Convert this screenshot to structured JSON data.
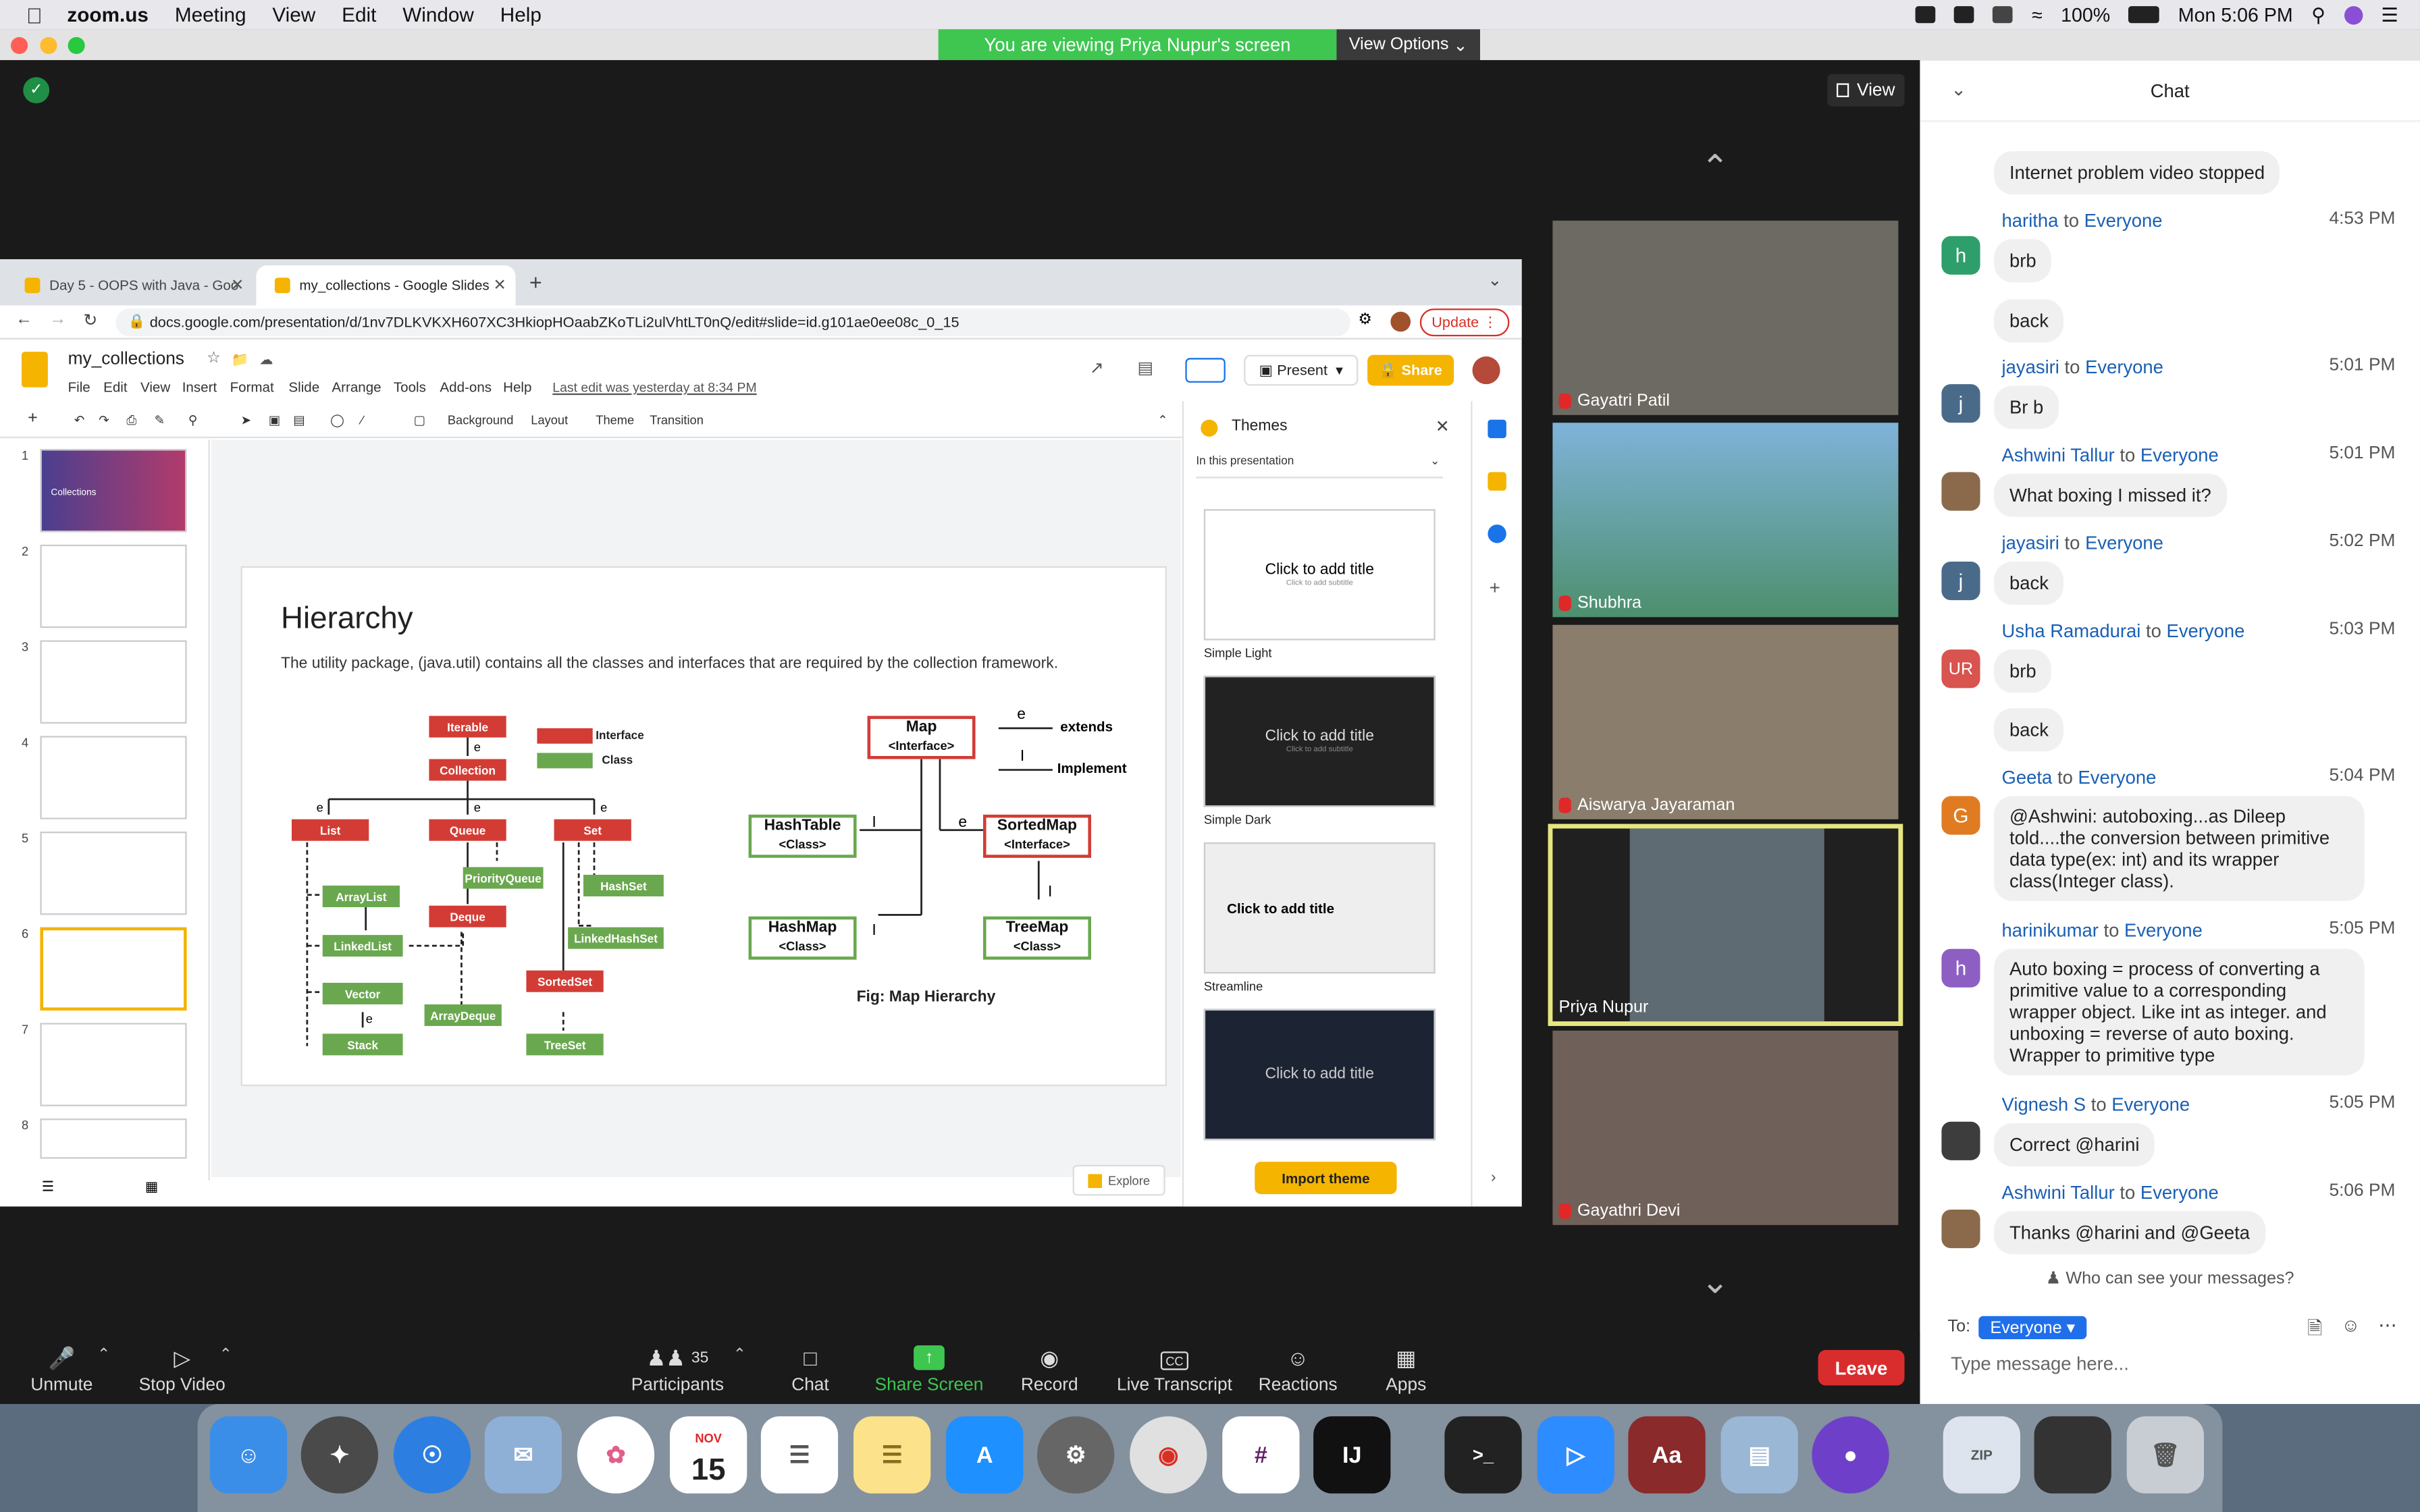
{
  "menubar": {
    "app": "zoom.us",
    "items": [
      "Meeting",
      "View",
      "Edit",
      "Window",
      "Help"
    ],
    "battery": "100%",
    "clock": "Mon 5:06 PM"
  },
  "share": {
    "banner": "You are viewing Priya Nupur's screen",
    "view_options": "View Options",
    "view_label": "View"
  },
  "browser": {
    "tabs": [
      "Day 5 - OOPS with Java - Goo",
      "my_collections - Google Slides"
    ],
    "url": "docs.google.com/presentation/d/1nv7DLKVKXH607XC3HkiopHOaabZKoTLi2ulVhtLT0nQ/edit#slide=id.g101ae0ee08c_0_15",
    "update": "Update"
  },
  "slides": {
    "doc_name": "my_collections",
    "menus": [
      "File",
      "Edit",
      "View",
      "Insert",
      "Format",
      "Slide",
      "Arrange",
      "Tools",
      "Add-ons",
      "Help"
    ],
    "last_edit": "Last edit was yesterday at 8:34 PM",
    "present": "Present",
    "share": "Share",
    "toolbar": [
      "Background",
      "Layout",
      "Theme",
      "Transition"
    ],
    "thumb_numbers": [
      "1",
      "2",
      "3",
      "4",
      "5",
      "6",
      "7",
      "8"
    ],
    "thumb_1_text": "Collections",
    "explore": "Explore"
  },
  "slide": {
    "title": "Hierarchy",
    "subtitle": "The utility package, (java.util) contains all the classes and interfaces that are required by the collection framework.",
    "legend": {
      "interface": "Interface",
      "class": "Class"
    },
    "collection_nodes": {
      "iterable": "Iterable",
      "collection": "Collection",
      "list": "List",
      "queue": "Queue",
      "set": "Set",
      "arraylist": "ArrayList",
      "linkedlist": "LinkedList",
      "vector": "Vector",
      "stack": "Stack",
      "priorityqueue": "PriorityQueue",
      "deque": "Deque",
      "arraydeque": "ArrayDeque",
      "hashset": "HashSet",
      "linkedhashset": "LinkedHashSet",
      "sortedset": "SortedSet",
      "treeset": "TreeSet"
    },
    "edge_labels": {
      "e": "e",
      "i": "I"
    },
    "map": {
      "map": "Map",
      "interface_tag": "<Interface>",
      "class_tag": "<Class>",
      "hashtable": "HashTable",
      "sortedmap": "SortedMap",
      "hashmap": "HashMap",
      "treemap": "TreeMap",
      "extends": "extends",
      "implement": "Implement",
      "caption": "Fig: Map Hierarchy"
    }
  },
  "themes": {
    "header": "Themes",
    "filter": "In this presentation",
    "card_title": "Click to add title",
    "card_sub": "Click to add subtitle",
    "names": [
      "Simple Light",
      "Simple Dark",
      "Streamline"
    ],
    "import": "Import theme"
  },
  "participants": [
    {
      "name": "Gayatri Patil"
    },
    {
      "name": "Shubhra"
    },
    {
      "name": "Aiswarya Jayaraman"
    },
    {
      "name": "Priya Nupur"
    },
    {
      "name": "Gayathri Devi"
    }
  ],
  "chat": {
    "title": "Chat",
    "to_everyone": "to Everyone",
    "messages": [
      {
        "text": "Internet problem video stopped"
      },
      {
        "sender": "haritha",
        "time": "4:53 PM",
        "avatar": "h",
        "color": "#2e9e6a",
        "lines": [
          "brb",
          "back"
        ]
      },
      {
        "sender": "jayasiri",
        "time": "5:01 PM",
        "avatar": "j",
        "color": "#4a6a8a",
        "lines": [
          "Br b"
        ]
      },
      {
        "sender": "Ashwini Tallur",
        "time": "5:01 PM",
        "lines": [
          "What boxing I missed it?"
        ]
      },
      {
        "sender": "jayasiri",
        "time": "5:02 PM",
        "avatar": "j",
        "color": "#4a6a8a",
        "lines": [
          "back"
        ]
      },
      {
        "sender": "Usha Ramadurai",
        "time": "5:03 PM",
        "avatar": "UR",
        "color": "#d9534f",
        "lines": [
          "brb",
          "back"
        ]
      },
      {
        "sender": "Geeta",
        "time": "5:04 PM",
        "avatar": "G",
        "color": "#e07b22",
        "lines": [
          "@Ashwini: autoboxing...as Dileep told....the conversion between primitive data type(ex: int) and its wrapper class(Integer class)."
        ]
      },
      {
        "sender": "harinikumar",
        "time": "5:05 PM",
        "avatar": "h",
        "color": "#8e5fc2",
        "lines": [
          "Auto boxing = process of converting a primitive value to a corresponding wrapper object. Like int as integer. and unboxing = reverse of auto boxing. Wrapper to primitive type"
        ]
      },
      {
        "sender": "Vignesh S",
        "time": "5:05 PM",
        "lines": [
          "Correct @harini"
        ]
      },
      {
        "sender": "Ashwini Tallur",
        "time": "5:06 PM",
        "lines": [
          "Thanks @harini and @Geeta"
        ]
      }
    ],
    "who_can_see": "Who can see your messages?",
    "to_label": "To:",
    "to_value": "Everyone",
    "input_placeholder": "Type message here..."
  },
  "toolbar": {
    "unmute": "Unmute",
    "stop_video": "Stop Video",
    "participants": "Participants",
    "participants_count": "35",
    "chat": "Chat",
    "share_screen": "Share Screen",
    "record": "Record",
    "live_transcript": "Live Transcript",
    "reactions": "Reactions",
    "apps": "Apps",
    "leave": "Leave"
  },
  "dock": {
    "calendar_month": "NOV",
    "calendar_day": "15"
  }
}
